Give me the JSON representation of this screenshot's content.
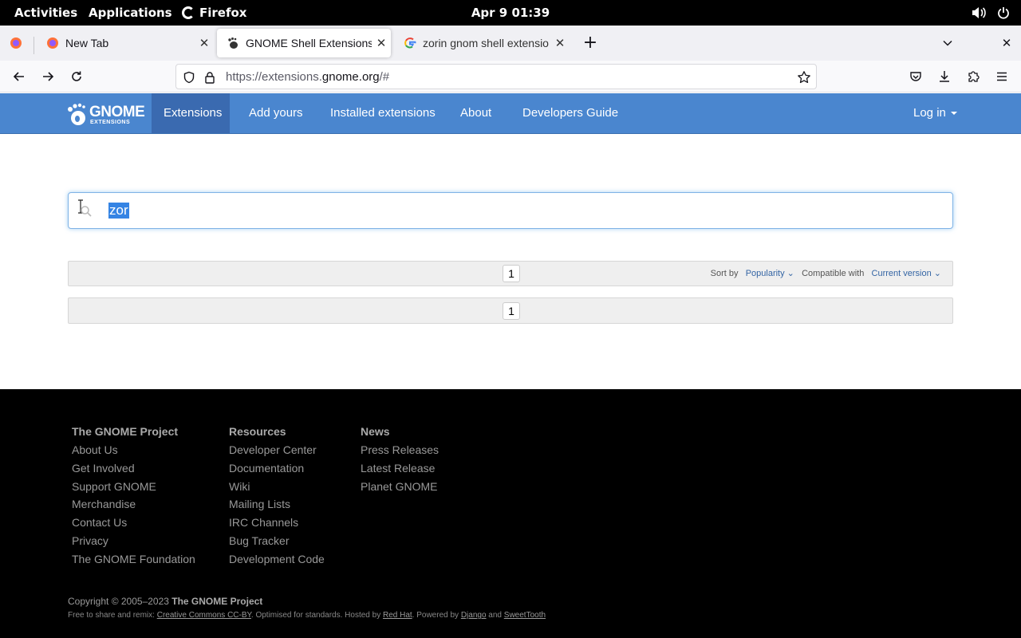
{
  "topbar": {
    "activities": "Activities",
    "applications": "Applications",
    "app_name": "Firefox",
    "clock": "Apr 9  01:39",
    "tray_icons": [
      "volume-icon",
      "power-icon"
    ]
  },
  "browser": {
    "tabs": [
      {
        "title": "New Tab",
        "icon": "firefox-icon",
        "active": false
      },
      {
        "title": "GNOME Shell Extensions",
        "icon": "gnome-foot-icon",
        "active": true
      },
      {
        "title": "zorin gnom shell extensio",
        "icon": "google-icon",
        "active": false
      }
    ],
    "new_tab": "+",
    "url_host_prefix": "https://extensions.",
    "url_host_domain": "gnome.org",
    "url_path": "/#"
  },
  "site": {
    "logo_word": "GNOME",
    "logo_sub": "EXTENSIONS",
    "nav": [
      "Extensions",
      "Add yours",
      "Installed extensions",
      "About",
      "Developers Guide"
    ],
    "login": "Log in"
  },
  "search": {
    "value": "zor"
  },
  "results": {
    "page": "1",
    "sort_by_label": "Sort by",
    "sort_by_value": "Popularity",
    "compat_label": "Compatible with",
    "compat_value": "Current version"
  },
  "footer": {
    "col1": {
      "heading": "The GNOME Project",
      "links": [
        "About Us",
        "Get Involved",
        "Support GNOME",
        "Merchandise",
        "Contact Us",
        "Privacy",
        "The GNOME Foundation"
      ]
    },
    "col2": {
      "heading": "Resources",
      "links": [
        "Developer Center",
        "Documentation",
        "Wiki",
        "Mailing Lists",
        "IRC Channels",
        "Bug Tracker",
        "Development Code"
      ]
    },
    "col3": {
      "heading": "News",
      "links": [
        "Press Releases",
        "Latest Release",
        "Planet GNOME"
      ]
    },
    "copyright_prefix": "Copyright © 2005–2023 ",
    "copyright_owner": "The GNOME Project",
    "remix_1": "Free to share and remix: ",
    "remix_link_1": "Creative Commons CC-BY",
    "remix_2": ". Optimised for standards. Hosted by ",
    "remix_link_2": "Red Hat",
    "remix_3": ". Powered by ",
    "remix_link_3": "Django",
    "remix_4": " and ",
    "remix_link_4": "SweetTooth"
  }
}
